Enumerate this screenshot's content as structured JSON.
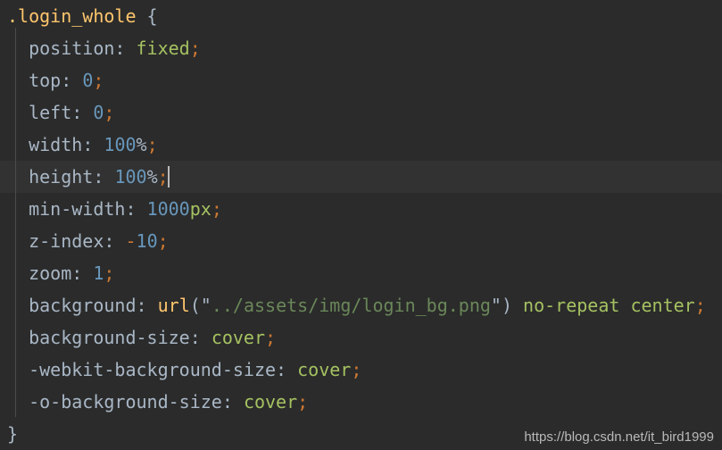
{
  "editor": {
    "theme_name": "darcula",
    "background_color": "#2b2b2b",
    "current_line_color": "#323232",
    "default_text_color": "#a9b7c6",
    "language": "css"
  },
  "watermark": {
    "text": "https://blog.csdn.net/it_bird1999"
  },
  "code": {
    "line1": {
      "selector": ".login_whole",
      "space": " ",
      "open_brace": "{"
    },
    "line2": {
      "indent": "  ",
      "property": "position",
      "colon": ": ",
      "value": "fixed",
      "semicolon": ";"
    },
    "line3": {
      "indent": "  ",
      "property": "top",
      "colon": ": ",
      "value": "0",
      "semicolon": ";"
    },
    "line4": {
      "indent": "  ",
      "property": "left",
      "colon": ": ",
      "value": "0",
      "semicolon": ";"
    },
    "line5": {
      "indent": "  ",
      "property": "width",
      "colon": ": ",
      "value": "100",
      "unit": "%",
      "semicolon": ";"
    },
    "line6": {
      "indent": "  ",
      "property": "height",
      "colon": ": ",
      "value": "100",
      "unit": "%",
      "semicolon": ";",
      "is_current_line": true,
      "has_caret": true
    },
    "line7": {
      "indent": "  ",
      "property": "min-width",
      "colon": ": ",
      "value": "1000",
      "unit": "px",
      "semicolon": ";"
    },
    "line8": {
      "indent": "  ",
      "property": "z-index",
      "colon": ": ",
      "sign": "-",
      "value": "10",
      "semicolon": ";"
    },
    "line9": {
      "indent": "  ",
      "property": "zoom",
      "colon": ": ",
      "value": "1",
      "semicolon": ";"
    },
    "line10": {
      "indent": "  ",
      "property": "background",
      "colon": ": ",
      "func": "url",
      "open_paren": "(",
      "quote_open": "\"",
      "string": "../assets/img/login_bg.png",
      "quote_close": "\"",
      "close_paren": ")",
      "space1": " ",
      "keyword1": "no-repeat",
      "space2": " ",
      "keyword2": "center",
      "semicolon": ";"
    },
    "line11": {
      "indent": "  ",
      "property": "background-size",
      "colon": ": ",
      "value": "cover",
      "semicolon": ";"
    },
    "line12": {
      "indent": "  ",
      "property": "-webkit-background-size",
      "colon": ": ",
      "value": "cover",
      "semicolon": ";"
    },
    "line13": {
      "indent": "  ",
      "property": "-o-background-size",
      "colon": ": ",
      "value": "cover",
      "semicolon": ";"
    },
    "line14": {
      "close_brace": "}"
    }
  }
}
